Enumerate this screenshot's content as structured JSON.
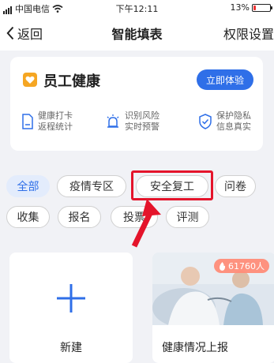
{
  "status": {
    "carrier": "中国电信",
    "time": "下午12:11",
    "battery": "13%"
  },
  "nav": {
    "back": "返回",
    "title": "智能填表",
    "right": "权限设置"
  },
  "card": {
    "title": "员工健康",
    "button": "立即体验",
    "features": [
      {
        "icon": "document-icon",
        "line1": "健康打卡",
        "line2": "返程统计"
      },
      {
        "icon": "alarm-icon",
        "line1": "识别风险",
        "line2": "实时预警"
      },
      {
        "icon": "shield-check-icon",
        "line1": "保护隐私",
        "line2": "信息真实"
      }
    ]
  },
  "chips": [
    "全部",
    "疫情专区",
    "安全复工",
    "问卷",
    "收集",
    "报名",
    "投票",
    "评测"
  ],
  "tiles": {
    "new_label": "新建",
    "template_label": "健康情况上报",
    "template_count": "61760人"
  },
  "colors": {
    "accent": "#2f6fe8",
    "highlight": "#e4142b",
    "card_logo": "#f5a623"
  }
}
